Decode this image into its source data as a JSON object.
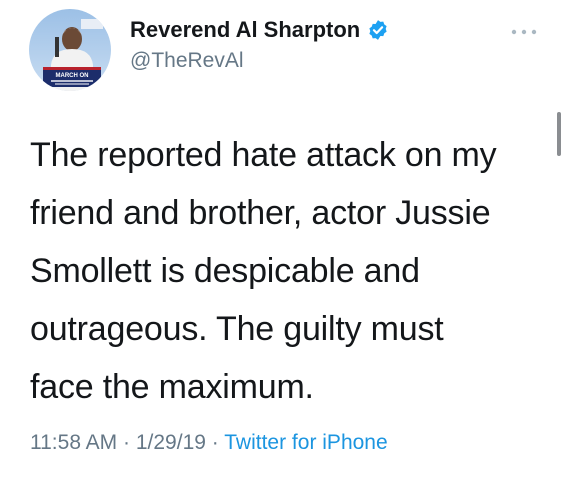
{
  "tweet": {
    "author": {
      "display_name": "Reverend Al Sharpton",
      "handle": "@TheRevAl",
      "verified": true,
      "avatar_sign_text": "MARCH ON"
    },
    "text_lines": [
      "The reported hate attack on my",
      "friend and brother, actor Jussie",
      "Smollett is despicable and",
      "outrageous. The guilty must",
      "face the maximum."
    ],
    "time": "11:58 AM",
    "date": "1/29/19",
    "separator": "·",
    "source": "Twitter for iPhone"
  },
  "icons": {
    "verified": "verified-badge-icon",
    "more": "more-options-icon"
  },
  "colors": {
    "name": "#14171a",
    "secondary": "#657786",
    "link": "#1b95e0",
    "verified": "#1da1f2"
  }
}
